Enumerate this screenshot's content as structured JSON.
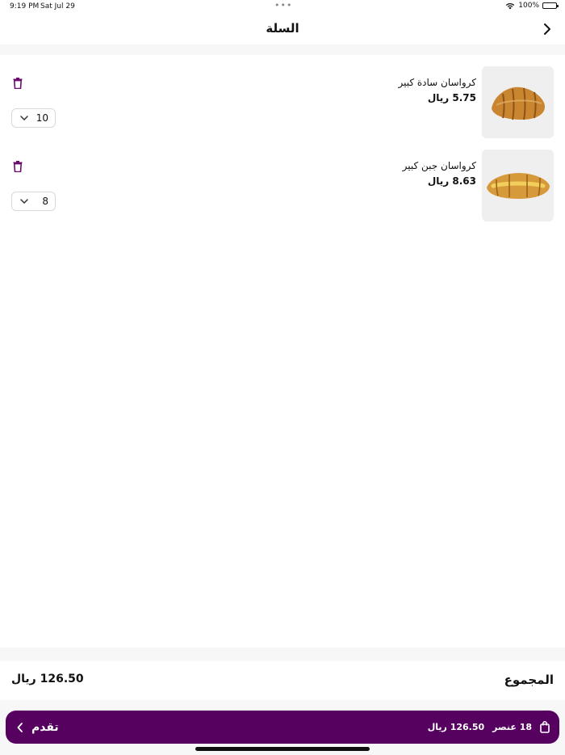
{
  "status_bar": {
    "time": "9:19 PM",
    "date": "Sat Jul 29",
    "battery": "100%",
    "multitask_dots": "•••"
  },
  "header": {
    "title": "السلة"
  },
  "cart": {
    "items": [
      {
        "name": "كرواسان سادة كبير",
        "price": "5.75 ريال",
        "quantity": "10",
        "image_icon": "croissant-plain-image"
      },
      {
        "name": "كرواسان جبن كبير",
        "price": "8.63 ريال",
        "quantity": "8",
        "image_icon": "croissant-cheese-image"
      }
    ]
  },
  "total": {
    "label": "المجموع",
    "value": "126.50 ريال"
  },
  "checkout": {
    "proceed_label": "تقدم",
    "item_count": "18 عنصر",
    "amount": "126.50 ريال"
  },
  "colors": {
    "primary": "#560060",
    "icon_accent": "#6a0f6e",
    "band": "#f7f7f7"
  }
}
